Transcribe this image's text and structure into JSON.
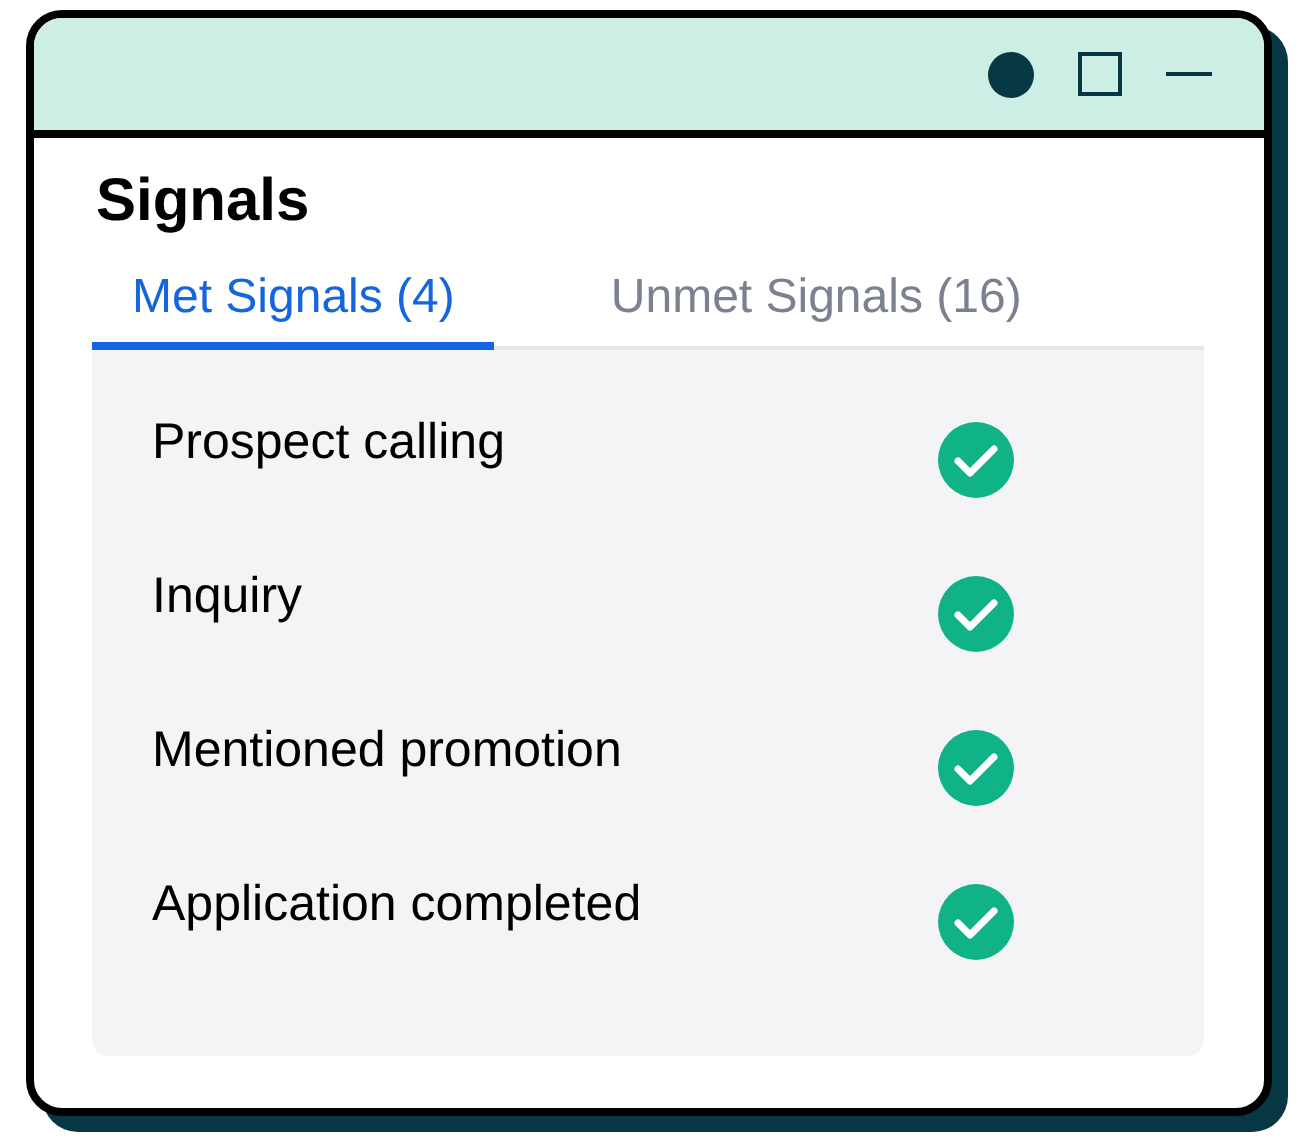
{
  "window": {
    "title": "Signals"
  },
  "tabs": [
    {
      "label": "Met Signals (4)",
      "selected": true
    },
    {
      "label": "Unmet Signals (16)",
      "selected": false
    }
  ],
  "signals": [
    {
      "name": "Prospect calling",
      "met": true
    },
    {
      "name": "Inquiry",
      "met": true
    },
    {
      "name": "Mentioned promotion",
      "met": true
    },
    {
      "name": "Application completed",
      "met": true
    }
  ]
}
